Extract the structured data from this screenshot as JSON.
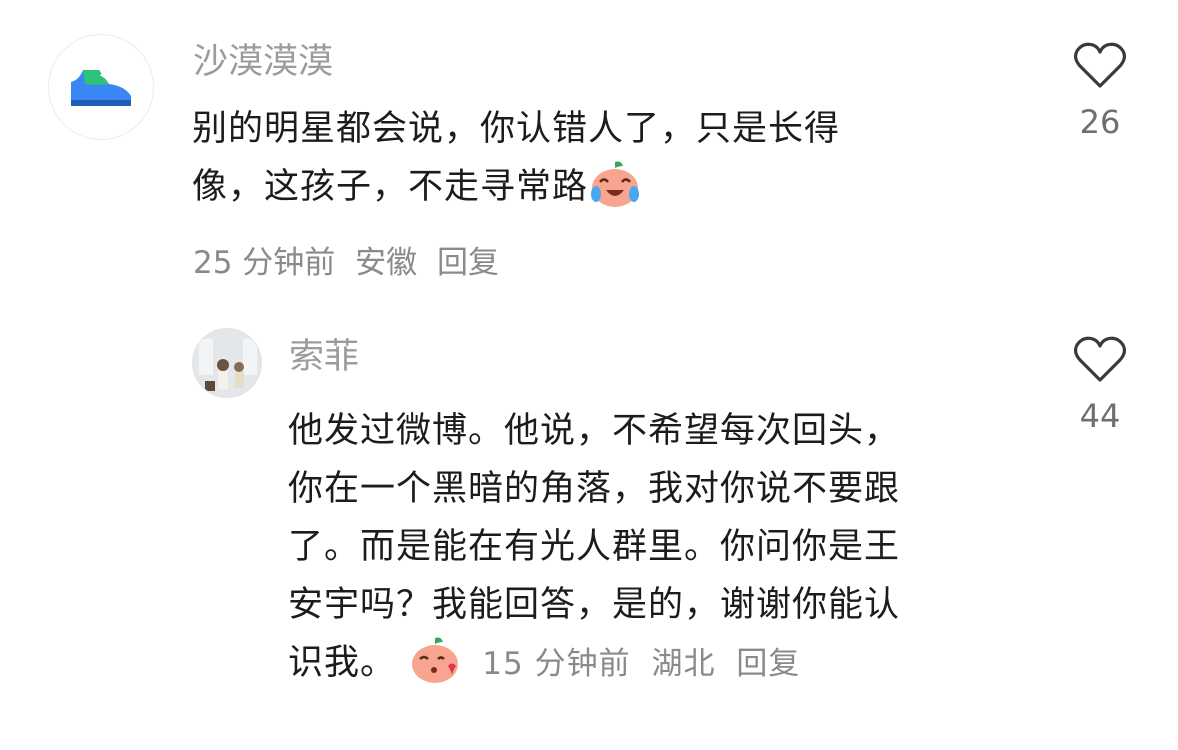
{
  "comments": [
    {
      "username": "沙漠漠漠",
      "text_line1": "别的明星都会说，你认错人了，只是长得",
      "text_line2": "像，这孩子，不走寻常路",
      "emoji": "crying-laughing-peach-emoji",
      "time": "25 分钟前",
      "location": "安徽",
      "reply_label": "回复",
      "like_count": "26",
      "avatar_icon": "sneaker-icon"
    },
    {
      "username": "索菲",
      "text_lines": [
        "他发过微博。他说，不希望每次回头，",
        "你在一个黑暗的角落，我对你说不要跟",
        "了。而是能在有光人群里。你问你是王",
        "安宇吗？我能回答，是的，谢谢你能认"
      ],
      "text_last": "识我。",
      "emoji": "blowing-kiss-peach-emoji",
      "time": "15 分钟前",
      "location": "湖北",
      "reply_label": "回复",
      "like_count": "44",
      "avatar_icon": "photo-avatar"
    }
  ],
  "colors": {
    "username": "#9c9c9c",
    "content": "#1c1c1c",
    "meta": "#8a8a8a",
    "heart_stroke": "#3a3a3a"
  }
}
